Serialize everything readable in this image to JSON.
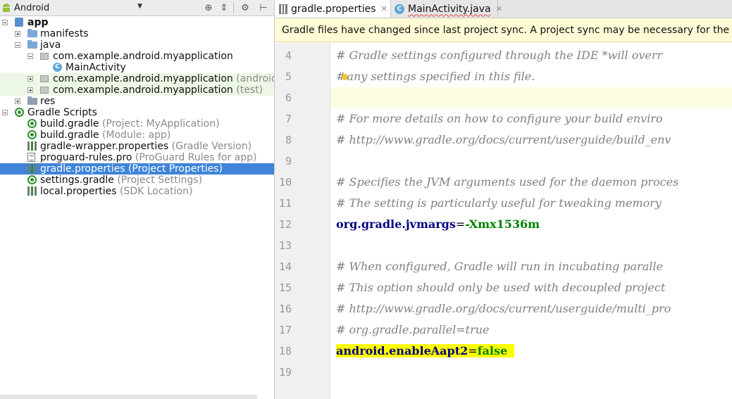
{
  "project_view": {
    "mode": "Android",
    "toolbar_icons": [
      "sync-target-icon",
      "collapse-icon",
      "settings-icon",
      "hide-icon"
    ]
  },
  "tree": [
    {
      "label": "app",
      "hint": "",
      "level": 0,
      "expander": "minus",
      "icon": "app-module-icon",
      "bold": true,
      "style": ""
    },
    {
      "label": "manifests",
      "hint": "",
      "level": 1,
      "expander": "plus",
      "icon": "folder-icon",
      "style": ""
    },
    {
      "label": "java",
      "hint": "",
      "level": 1,
      "expander": "minus",
      "icon": "folder-icon",
      "style": ""
    },
    {
      "label": "com.example.android.myapplication",
      "hint": "",
      "level": 2,
      "expander": "minus",
      "icon": "package-icon",
      "style": ""
    },
    {
      "label": "MainActivity",
      "hint": "",
      "level": 3,
      "expander": "",
      "icon": "class-icon",
      "style": ""
    },
    {
      "label": "com.example.android.myapplication",
      "hint": "(androidT",
      "level": 2,
      "expander": "plus",
      "icon": "package-icon",
      "style": "test"
    },
    {
      "label": "com.example.android.myapplication",
      "hint": "(test)",
      "level": 2,
      "expander": "plus",
      "icon": "package-icon",
      "style": "test"
    },
    {
      "label": "res",
      "hint": "",
      "level": 1,
      "expander": "plus",
      "icon": "res-folder-icon",
      "style": ""
    },
    {
      "label": "Gradle Scripts",
      "hint": "",
      "level": 0,
      "expander": "minus",
      "icon": "gradle-icon",
      "style": ""
    },
    {
      "label": "build.gradle",
      "hint": "(Project: MyApplication)",
      "level": 1,
      "expander": "",
      "icon": "gradle-icon",
      "style": ""
    },
    {
      "label": "build.gradle",
      "hint": "(Module: app)",
      "level": 1,
      "expander": "",
      "icon": "gradle-icon",
      "style": ""
    },
    {
      "label": "gradle-wrapper.properties",
      "hint": "(Gradle Version)",
      "level": 1,
      "expander": "",
      "icon": "gradle-properties-icon",
      "style": ""
    },
    {
      "label": "proguard-rules.pro",
      "hint": "(ProGuard Rules for app)",
      "level": 1,
      "expander": "",
      "icon": "proguard-file-icon",
      "style": ""
    },
    {
      "label": "gradle.properties",
      "hint": "(Project Properties)",
      "level": 1,
      "expander": "",
      "icon": "gradle-properties-icon",
      "style": "selected"
    },
    {
      "label": "settings.gradle",
      "hint": "(Project Settings)",
      "level": 1,
      "expander": "",
      "icon": "gradle-icon",
      "style": ""
    },
    {
      "label": "local.properties",
      "hint": "(SDK Location)",
      "level": 1,
      "expander": "",
      "icon": "gradle-properties-icon",
      "style": ""
    }
  ],
  "tabs": [
    {
      "label": "gradle.properties",
      "icon": "properties-file-icon",
      "active": true,
      "squiggle": false
    },
    {
      "label": "MainActivity.java",
      "icon": "class-icon",
      "active": false,
      "squiggle": true
    }
  ],
  "banner": {
    "text": "Gradle files have changed since last project sync. A project sync may be necessary for the IDE to"
  },
  "editor": {
    "current_line": 6,
    "lines": [
      {
        "n": "4",
        "parts": [
          {
            "t": "# Gradle settings configured through the IDE *will overr",
            "c": "c-comment"
          }
        ]
      },
      {
        "n": "5",
        "bulb": true,
        "parts": [
          {
            "t": "#",
            "c": "c-comment"
          },
          {
            "t": "any settings specified in this file.",
            "c": "c-comment"
          }
        ]
      },
      {
        "n": "6",
        "parts": []
      },
      {
        "n": "7",
        "parts": [
          {
            "t": "# For more details on how to configure your build enviro",
            "c": "c-comment"
          }
        ]
      },
      {
        "n": "8",
        "parts": [
          {
            "t": "# http://www.gradle.org/docs/current/userguide/build_env",
            "c": "c-comment"
          }
        ]
      },
      {
        "n": "9",
        "parts": []
      },
      {
        "n": "10",
        "parts": [
          {
            "t": "# Specifies the JVM arguments used for the daemon proces",
            "c": "c-comment"
          }
        ]
      },
      {
        "n": "11",
        "parts": [
          {
            "t": "# The setting is particularly useful for tweaking memory",
            "c": "c-comment"
          }
        ]
      },
      {
        "n": "12",
        "parts": [
          {
            "t": "org.gradle.jvmargs",
            "c": "c-key"
          },
          {
            "t": "=",
            "c": "c-eq"
          },
          {
            "t": "-Xmx1536m",
            "c": "c-val"
          }
        ]
      },
      {
        "n": "13",
        "parts": []
      },
      {
        "n": "14",
        "parts": [
          {
            "t": "# When configured, Gradle will run in incubating paralle",
            "c": "c-comment"
          }
        ]
      },
      {
        "n": "15",
        "parts": [
          {
            "t": "# This option should only be used with decoupled project",
            "c": "c-comment"
          }
        ]
      },
      {
        "n": "16",
        "parts": [
          {
            "t": "# http://www.gradle.org/docs/current/userguide/multi_pro",
            "c": "c-comment"
          }
        ]
      },
      {
        "n": "17",
        "parts": [
          {
            "t": "# org.gradle.parallel=true",
            "c": "c-comment"
          }
        ]
      },
      {
        "n": "18",
        "highlight": true,
        "parts": [
          {
            "t": "android.enableAapt2",
            "c": "c-key"
          },
          {
            "t": "=",
            "c": "c-eq"
          },
          {
            "t": "false",
            "c": "c-val"
          }
        ]
      },
      {
        "n": "19",
        "parts": []
      }
    ]
  },
  "colors": {
    "selection": "#3f84d8",
    "banner_bg": "#fffbd6",
    "highlight": "#ffff00",
    "comment": "#808080",
    "key": "#000080",
    "value": "#008000"
  }
}
